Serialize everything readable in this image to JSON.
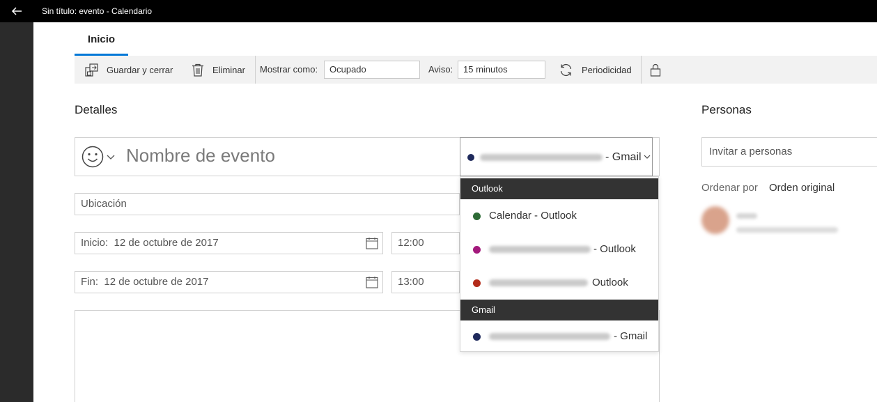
{
  "window": {
    "title": "Sin título: evento - Calendario"
  },
  "ribbon": {
    "tab_label": "Inicio"
  },
  "toolbar": {
    "save_close": "Guardar y cerrar",
    "delete": "Eliminar",
    "show_as_label": "Mostrar como:",
    "show_as_value": "Ocupado",
    "reminder_label": "Aviso:",
    "reminder_value": "15 minutos",
    "recurrence": "Periodicidad"
  },
  "details": {
    "heading": "Detalles",
    "event_name_placeholder": "Nombre de evento",
    "calendar_suffix": "- Gmail",
    "calendar_color": "#1f2a5c",
    "location_placeholder": "Ubicación",
    "start_label": "Inicio:",
    "start_date": "12 de octubre de 2017",
    "start_time": "12:00",
    "end_label": "Fin:",
    "end_date": "12 de octubre de 2017",
    "end_time": "13:00"
  },
  "calendar_dropdown": {
    "groups": [
      {
        "header": "Outlook",
        "items": [
          {
            "label": "Calendar - Outlook",
            "color": "#2e6b36"
          },
          {
            "suffix": "- Outlook",
            "color": "#a3197c"
          },
          {
            "suffix": "Outlook",
            "color": "#b32b1a"
          }
        ]
      },
      {
        "header": "Gmail",
        "items": [
          {
            "suffix": "- Gmail",
            "color": "#1f2a5c"
          }
        ]
      }
    ]
  },
  "people": {
    "heading": "Personas",
    "invite_placeholder": "Invitar a personas",
    "sort_label": "Ordenar por",
    "sort_value": "Orden original"
  }
}
